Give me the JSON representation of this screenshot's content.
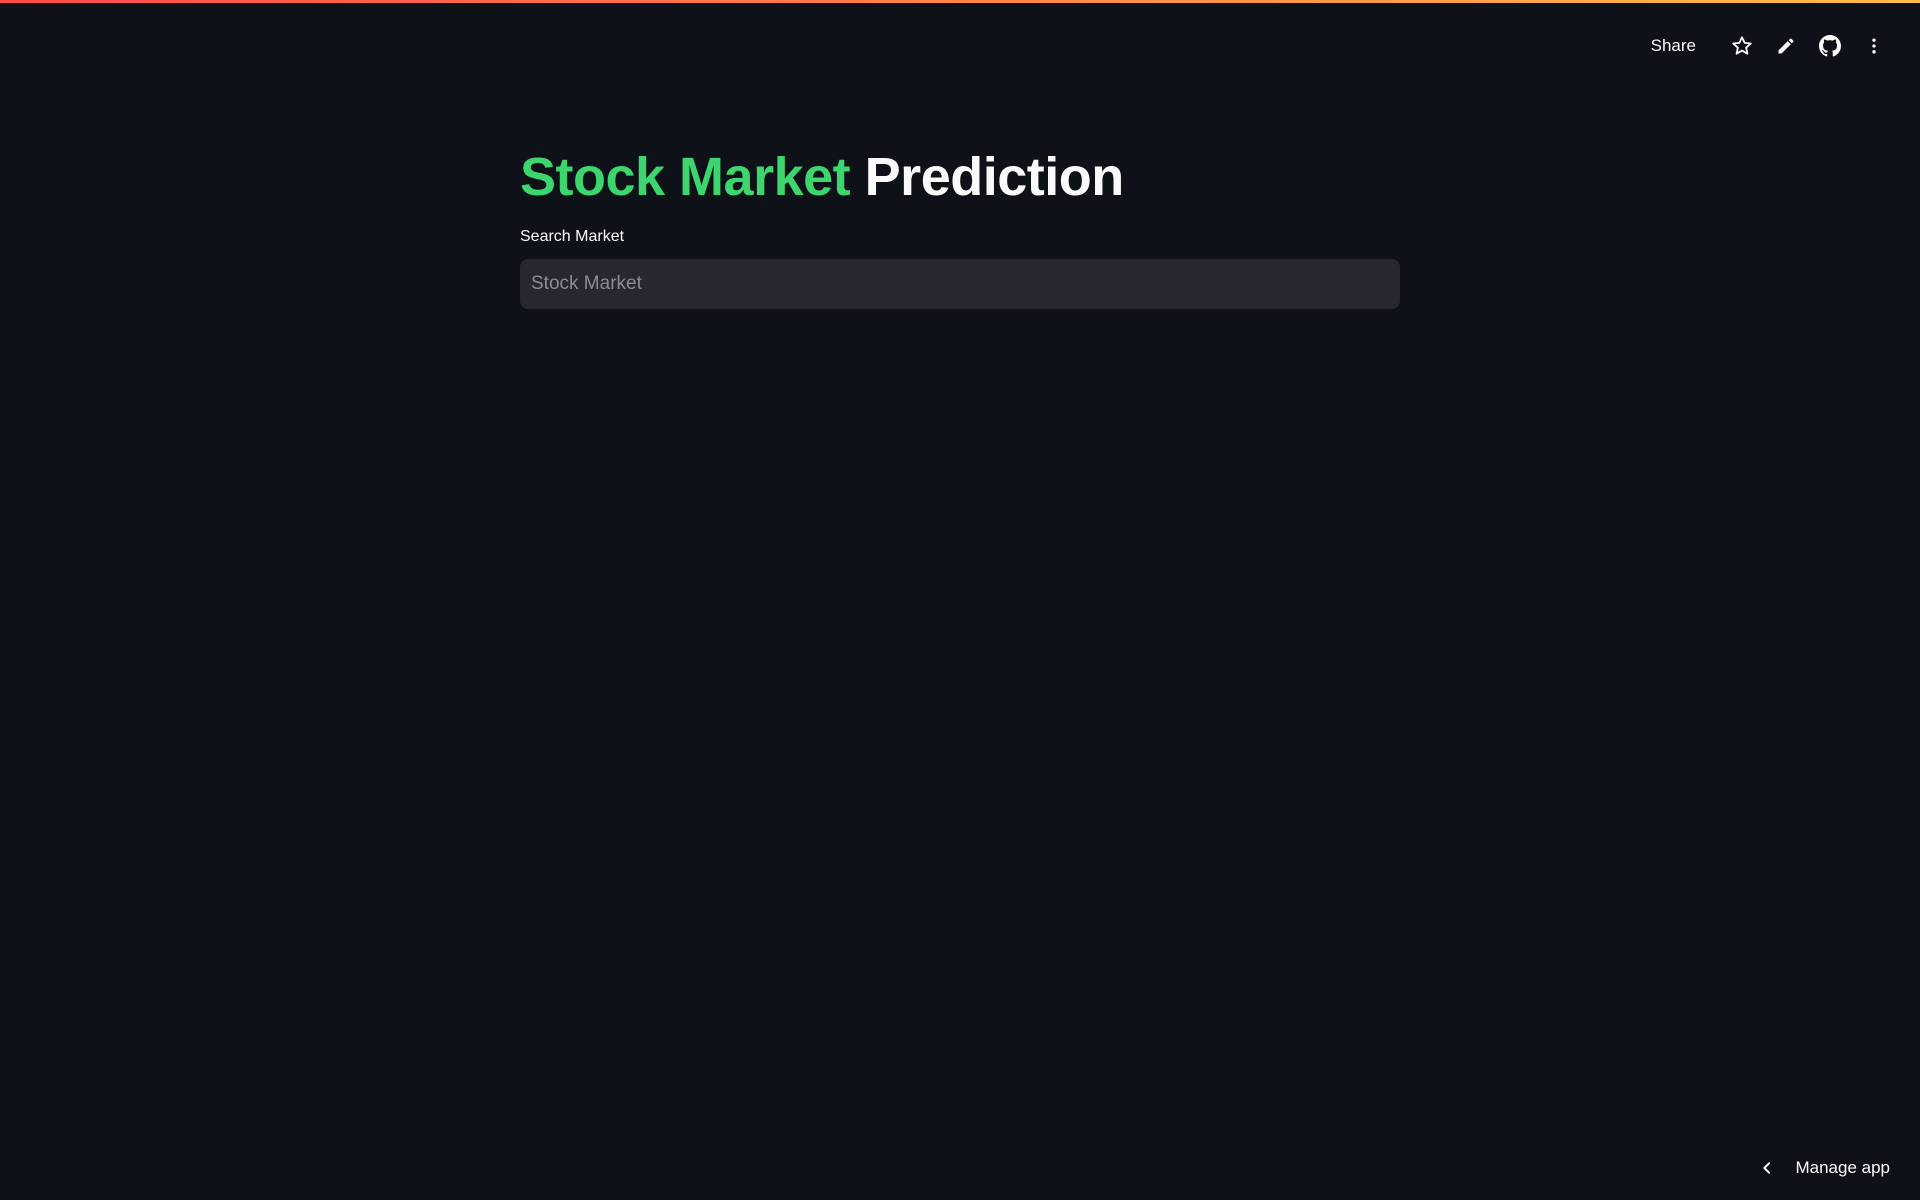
{
  "header": {
    "share_label": "Share",
    "icons": [
      "star-icon",
      "pencil-icon",
      "github-icon",
      "more-vertical-icon"
    ]
  },
  "main": {
    "title_accent": "Stock Market",
    "title_rest": "Prediction",
    "search": {
      "label": "Search Market",
      "placeholder": "Stock Market",
      "value": ""
    }
  },
  "footer": {
    "manage_app_label": "Manage app"
  },
  "colors": {
    "background": "#0e1117",
    "accent_green": "#3dd56d",
    "input_background": "#262730",
    "text": "#fafafa",
    "decoration_start": "#ff4b4b",
    "decoration_end": "#ffbd45"
  }
}
